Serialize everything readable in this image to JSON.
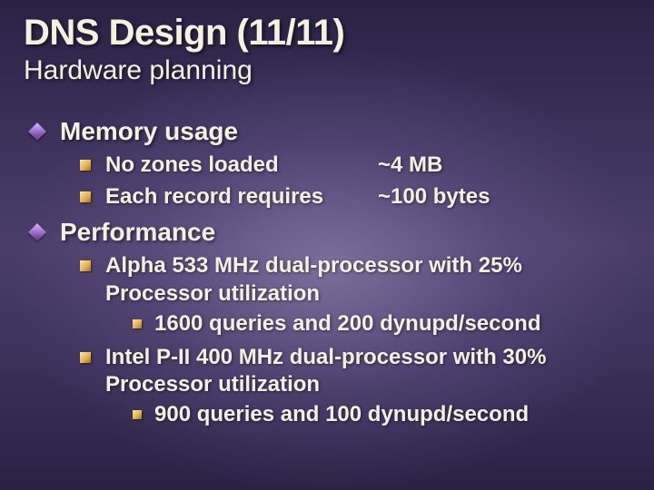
{
  "title": "DNS Design (11/11)",
  "subtitle": "Hardware planning",
  "sections": [
    {
      "heading": "Memory usage",
      "items": [
        {
          "label": "No zones loaded",
          "value": "~4 MB"
        },
        {
          "label": "Each record requires",
          "value": "~100 bytes"
        }
      ]
    },
    {
      "heading": "Performance",
      "items": [
        {
          "label": "Alpha 533 MHz dual-processor with 25% Processor utilization",
          "sub": "1600 queries and 200 dynupd/second"
        },
        {
          "label": "Intel P-II 400 MHz dual-processor with 30% Processor utilization",
          "sub": "900 queries and 100 dynupd/second"
        }
      ]
    }
  ]
}
